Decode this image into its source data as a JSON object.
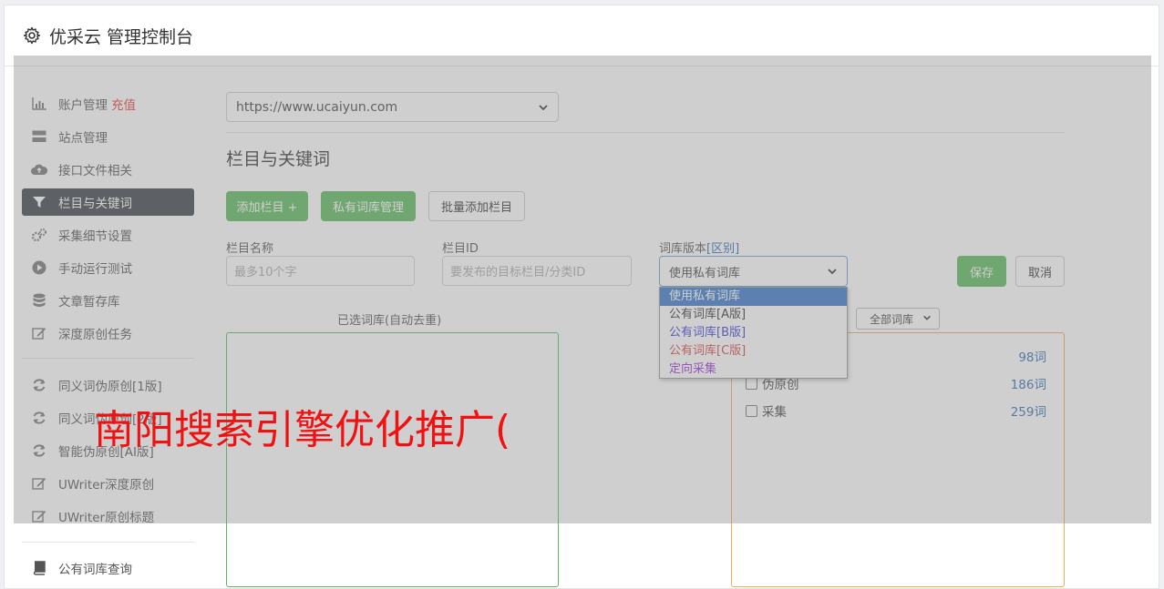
{
  "header": {
    "title": "优采云 管理控制台",
    "icon": "gear-icon"
  },
  "sidebar": {
    "items": [
      {
        "label": "账户管理",
        "extra": "充值",
        "icon": "bar-chart-icon"
      },
      {
        "label": "站点管理",
        "icon": "server-icon"
      },
      {
        "label": "接口文件相关",
        "icon": "cloud-upload-icon"
      },
      {
        "label": "栏目与关键词",
        "icon": "filter-icon",
        "active": true
      },
      {
        "label": "采集细节设置",
        "icon": "gears-icon"
      },
      {
        "label": "手动运行测试",
        "icon": "play-circle-icon"
      },
      {
        "label": "文章暂存库",
        "icon": "database-icon"
      },
      {
        "label": "深度原创任务",
        "icon": "edit-icon"
      },
      {
        "label": "同义词伪原创[1版]",
        "icon": "refresh-icon"
      },
      {
        "label": "同义词伪原创[2版]",
        "icon": "refresh-icon"
      },
      {
        "label": "智能伪原创[AI版]",
        "icon": "refresh-icon"
      },
      {
        "label": "UWriter深度原创",
        "icon": "edit-icon"
      },
      {
        "label": "UWriter原创标题",
        "icon": "edit-icon"
      },
      {
        "label": "公有词库查询",
        "icon": "book-icon"
      }
    ]
  },
  "main": {
    "site_select": "https://www.ucaiyun.com",
    "section_title": "栏目与关键词",
    "buttons": {
      "add_column": "添加栏目 +",
      "private_lib": "私有词库管理",
      "batch_add": "批量添加栏目",
      "save": "保存",
      "cancel": "取消"
    },
    "form": {
      "name_label": "栏目名称",
      "name_placeholder": "最多10个字",
      "id_label": "栏目ID",
      "id_placeholder": "要发布的目标栏目/分类ID",
      "version_label": "词库版本",
      "version_link": "[区别]",
      "version_value": "使用私有词库"
    },
    "dropdown_options": [
      {
        "label": "使用私有词库",
        "color": "#ffffff"
      },
      {
        "label": "公有词库[A版]",
        "color": "#333333"
      },
      {
        "label": "公有词库[B版]",
        "color": "#3a3ad6"
      },
      {
        "label": "公有词库[C版]",
        "color": "#d64545"
      },
      {
        "label": "定向采集",
        "color": "#9b30d6"
      }
    ],
    "selected_caption": "已选词库(自动去重)",
    "lib_filter": "全部词库",
    "libs": [
      {
        "name": "",
        "count": "98词"
      },
      {
        "name": "伪原创",
        "count": "186词"
      },
      {
        "name": "采集",
        "count": "259词"
      }
    ]
  },
  "watermark": "南阳搜索引擎优化推广("
}
